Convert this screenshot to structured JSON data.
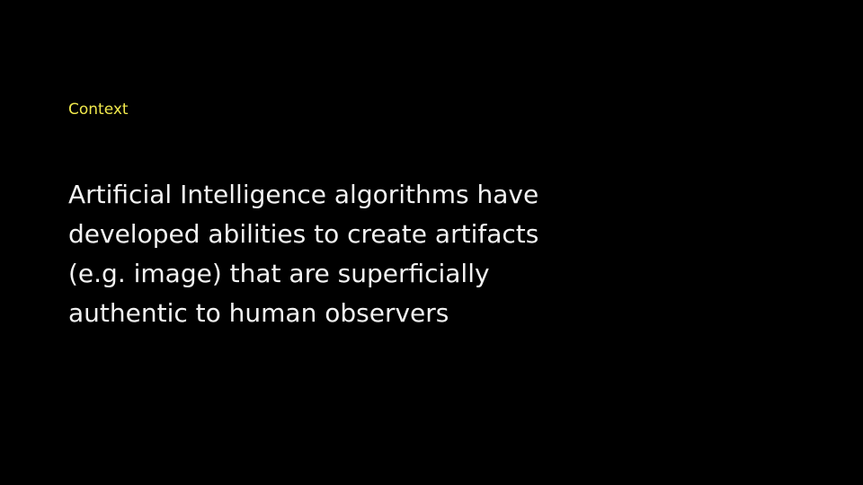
{
  "slide": {
    "eyebrow": "Context",
    "body_lines": [
      "Artificial Intelligence algorithms have",
      "developed abilities to create artifacts",
      "(e.g. image) that are superficially",
      "authentic to human observers"
    ]
  },
  "colors": {
    "background": "#000000",
    "eyebrow": "#f1e94c",
    "body_text": "#f2f2f2"
  }
}
